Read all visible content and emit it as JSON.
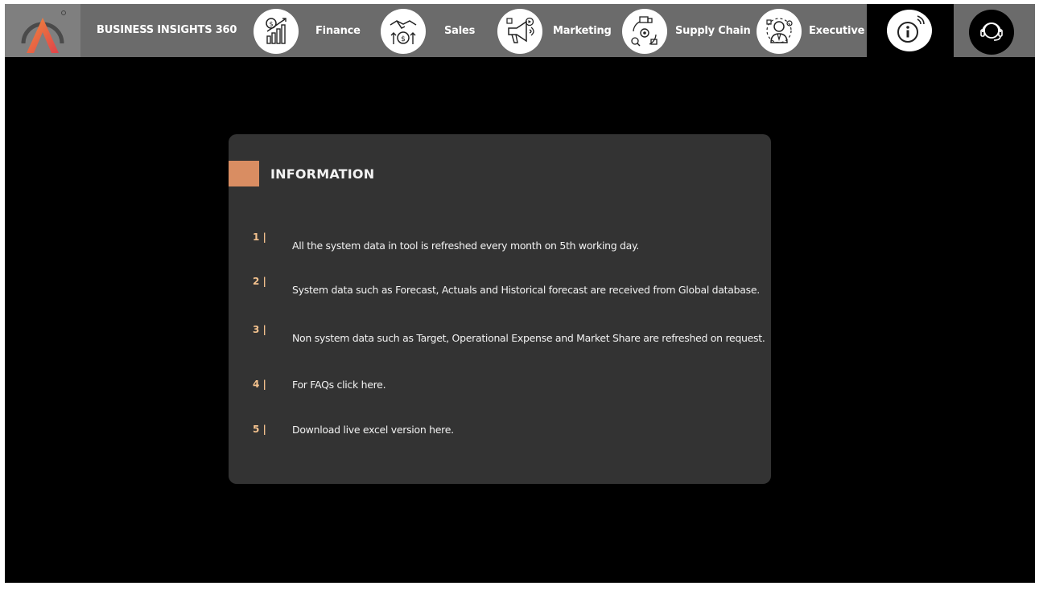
{
  "header": {
    "app_title": "BUSINESS INSIGHTS 360",
    "logo_icon": "brand-a-logo",
    "nav": [
      {
        "label": "Finance",
        "icon": "finance-growth-chart-icon"
      },
      {
        "label": "Sales",
        "icon": "handshake-dollar-icon"
      },
      {
        "label": "Marketing",
        "icon": "megaphone-icon"
      },
      {
        "label": "Supply Chain",
        "icon": "supply-chain-cycle-icon"
      },
      {
        "label": "Executive",
        "icon": "executive-person-icon"
      }
    ],
    "info_icon": "info-icon",
    "support_icon": "support-headset-icon"
  },
  "info_panel": {
    "title": "INFORMATION",
    "accent_color": "#d98d62",
    "items": [
      {
        "number": "1 |",
        "text": "All the system data in tool is refreshed every month on 5th working day."
      },
      {
        "number": "2 |",
        "text": "System data such as Forecast, Actuals and Historical forecast are received from Global database."
      },
      {
        "number": "3 |",
        "text": "Non system data such as Target, Operational Expense and Market Share are refreshed on request."
      },
      {
        "number": "4 |",
        "text": "For FAQs click here."
      },
      {
        "number": "5 |",
        "text": "Download live excel version here."
      }
    ]
  },
  "colors": {
    "header_bg": "#6b6b6b",
    "canvas_bg": "#000000",
    "card_bg": "#333333",
    "number_color": "#f4c28e"
  }
}
